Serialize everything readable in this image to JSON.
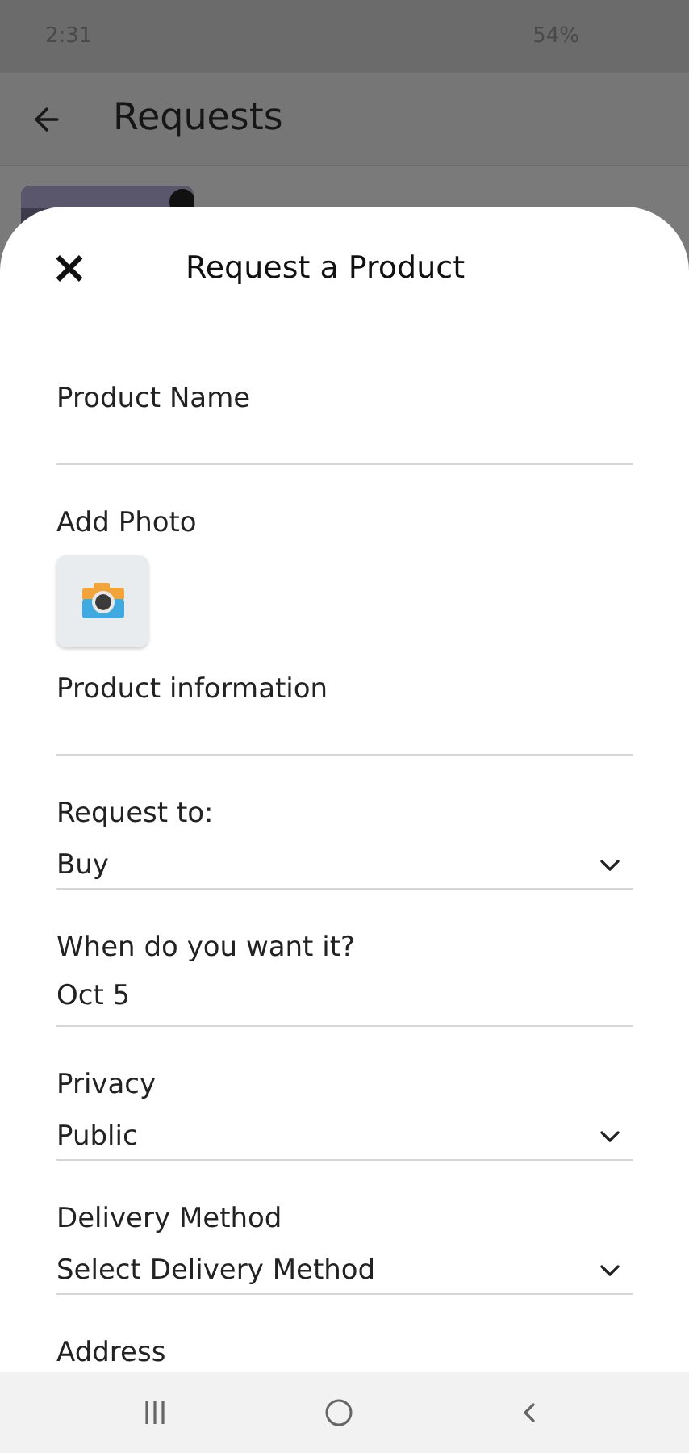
{
  "status_bar": {
    "time": "2:31",
    "battery": "54%"
  },
  "app_bar": {
    "title": "Requests"
  },
  "sheet": {
    "close": "×",
    "title": "Request a Product",
    "fields": [
      {
        "kind": "text",
        "label": "Product Name"
      },
      {
        "label": "Add Photo"
      },
      {
        "kind": "text",
        "label": "Product information"
      },
      {
        "kind": "select",
        "label": "Request to:",
        "value": "Buy"
      },
      {
        "kind": "value",
        "label": "When do you want it?",
        "value": "Oct 5"
      },
      {
        "kind": "select",
        "label": "Privacy",
        "value": "Public"
      },
      {
        "kind": "select",
        "label": "Delivery Method",
        "value": "Select Delivery Method"
      },
      {
        "kind": "heading",
        "label": "Address"
      }
    ]
  }
}
